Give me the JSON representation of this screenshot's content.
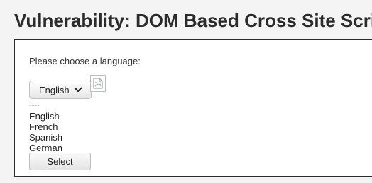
{
  "page": {
    "title": "Vulnerability: DOM Based Cross Site Scripting (XSS)"
  },
  "form": {
    "prompt": "Please choose a language:",
    "select": {
      "selected": "English",
      "options": [
        "----",
        "English",
        "French",
        "Spanish",
        "German"
      ]
    },
    "submit_label": "Select"
  },
  "icons": {
    "dropdown": "chevron-down-icon",
    "image": "broken-image-icon"
  }
}
